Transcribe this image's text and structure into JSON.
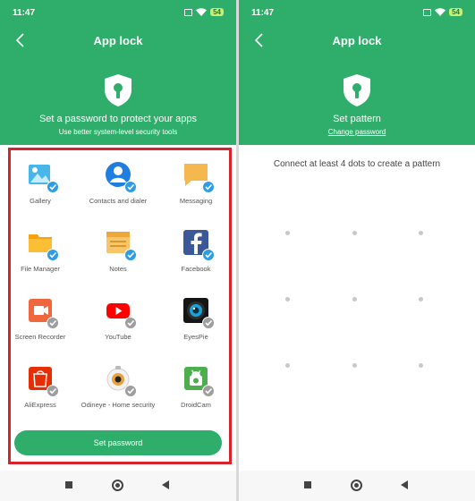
{
  "left": {
    "status": {
      "time": "11:47",
      "battery": "54"
    },
    "title": "App lock",
    "headline": "Set a password to protect your apps",
    "subline": "Use better system-level security tools",
    "apps": [
      {
        "label": "Gallery",
        "checked": true
      },
      {
        "label": "Contacts and dialer",
        "checked": true
      },
      {
        "label": "Messaging",
        "checked": true
      },
      {
        "label": "File Manager",
        "checked": true
      },
      {
        "label": "Notes",
        "checked": true
      },
      {
        "label": "Facebook",
        "checked": true
      },
      {
        "label": "Screen Recorder",
        "checked": false
      },
      {
        "label": "YouTube",
        "checked": false
      },
      {
        "label": "EyesPie",
        "checked": false
      },
      {
        "label": "AliExpress",
        "checked": false
      },
      {
        "label": "Odineye - Home security",
        "checked": false
      },
      {
        "label": "DroidCam",
        "checked": false
      }
    ],
    "button": "Set password"
  },
  "right": {
    "status": {
      "time": "11:47",
      "battery": "54"
    },
    "title": "App lock",
    "headline": "Set pattern",
    "link": "Change password",
    "instruction": "Connect at least 4 dots to create a pattern"
  },
  "colors": {
    "brand": "#2eae6a",
    "highlight": "#d8232a",
    "check_on": "#2f9de6",
    "check_off": "#9e9e9e"
  }
}
